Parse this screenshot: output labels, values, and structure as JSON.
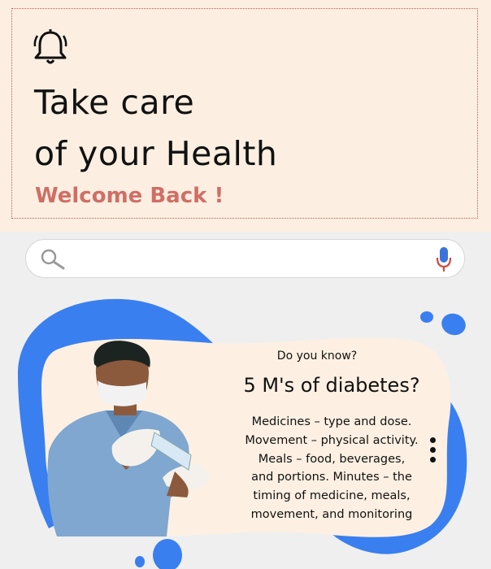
{
  "header": {
    "icon": "bell-icon",
    "title_line1": "Take care",
    "title_line2": "of your Health",
    "welcome": "Welcome Back !"
  },
  "search": {
    "placeholder": "",
    "value": "",
    "left_icon": "search-icon",
    "right_icon": "mic-icon"
  },
  "card": {
    "kicker": "Do you know?",
    "title": "5 M's of diabetes?",
    "body": "Medicines – type and dose.\nMovement – physical activity.\nMeals – food, beverages,\nand portions. Minutes – the\ntiming of medicine, meals,\nmovement, and monitoring",
    "menu_icon": "more-vertical-icon",
    "illustration": "doctor-illustration"
  },
  "colors": {
    "header_bg": "#fcefe1",
    "accent": "#d06e66",
    "blob_blue": "#3a7ff0",
    "card_bg": "#fdf0e2"
  }
}
